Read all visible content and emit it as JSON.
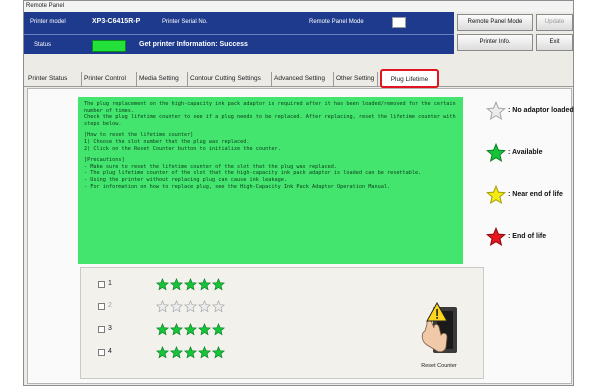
{
  "window": {
    "title": "Remote Panel"
  },
  "header": {
    "printer_model_label": "Printer model",
    "printer_model_value": "XP3-C6415R-P",
    "printer_serial_label": "Printer Serial No.",
    "remote_panel_mode_label": "Remote Panel Mode",
    "status_label": "Status",
    "status_message": "Get printer Information: Success",
    "status_color": "#23e03a"
  },
  "buttons": {
    "remote_panel_mode": "Remote Panel Mode",
    "unknown": "Update",
    "printer_info": "Printer Info.",
    "exit": "Exit"
  },
  "tabs": [
    {
      "label": "Printer Status"
    },
    {
      "label": "Printer Control"
    },
    {
      "label": "Media Setting"
    },
    {
      "label": "Contour Cutting Settings"
    },
    {
      "label": "Advanced Setting"
    },
    {
      "label": "Other Setting"
    },
    {
      "label": "Plug Lifetime",
      "active": true
    }
  ],
  "info": {
    "intro": "The plug replacement on the high-capacity ink pack adaptor is required after it has been loaded/removed for the certain number of times.\nCheck the plug lifetime counter to see if a plug needs to be replaced. After replacing, reset the lifetime counter with steps below.",
    "howto_title": "[How to reset the lifetime counter]",
    "howto_1": "1) Choose the slot number that the plug was replaced.",
    "howto_2": "2) Click on the Reset Counter button to initialize the counter.",
    "precautions_title": "[Precautions]",
    "precaution_1": "- Make sure to reset the lifetime counter of the slot that the plug was replaced.",
    "precaution_2": "- The plug lifetime counter of the slot that the high-capacity ink pack adaptor is loaded can be resettable.",
    "precaution_3": "- Using the printer without replacing plug can cause ink leakage.",
    "precaution_4": "- For information on how to replace plug, see the High-Capacity Ink Pack Adaptor Operation Manual."
  },
  "legend": [
    {
      "label": ": No adaptor loaded",
      "color": "#ececec",
      "stroke": "#a5a5a5",
      "icon": "star-icon"
    },
    {
      "label": ": Available",
      "color": "#16c43a",
      "stroke": "#0b7f23",
      "icon": "star-icon"
    },
    {
      "label": ": Near end of life",
      "color": "#f3ea16",
      "stroke": "#a39b00",
      "icon": "star-icon"
    },
    {
      "label": ": End of life",
      "color": "#e5161e",
      "stroke": "#8a0a0f",
      "icon": "star-icon"
    }
  ],
  "slots": [
    {
      "number": "1",
      "state": "available",
      "stars": 5,
      "enabled": true,
      "checked": false
    },
    {
      "number": "2",
      "state": "no adaptor loaded",
      "stars": 5,
      "enabled": false,
      "checked": false
    },
    {
      "number": "3",
      "state": "available",
      "stars": 5,
      "enabled": true,
      "checked": false
    },
    {
      "number": "4",
      "state": "available",
      "stars": 5,
      "enabled": true,
      "checked": false
    }
  ],
  "reset": {
    "label": "Reset Counter",
    "icon": "reset-hand-warning-icon"
  },
  "colors": {
    "header_bg": "#1e3a8c",
    "info_bg": "#44e56e",
    "active_tab_outline": "#e0151f"
  }
}
